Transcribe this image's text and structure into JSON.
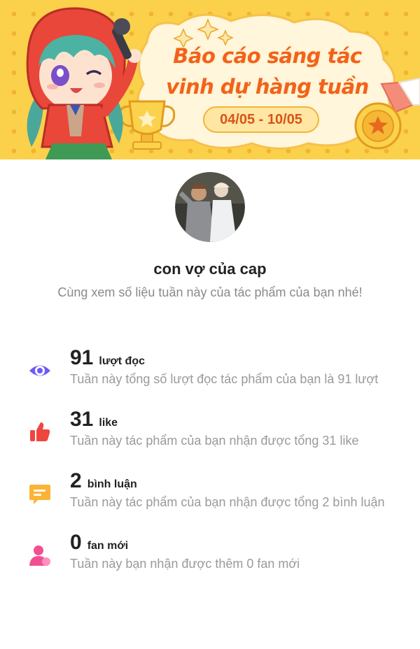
{
  "banner": {
    "title_line1": "Báo cáo sáng tác",
    "title_line2": "vinh dự hàng tuần",
    "date_range": "04/05 - 10/05"
  },
  "profile": {
    "username": "con vợ của cap",
    "subtitle": "Cùng xem số liệu tuần này của tác phẩm của bạn nhé!"
  },
  "stats": [
    {
      "icon": "eye-icon",
      "color": "#6b5cf5",
      "value": "91",
      "unit": "lượt đọc",
      "description": "Tuần này tổng số lượt đọc tác phẩm của bạn là 91 lượt"
    },
    {
      "icon": "thumbs-up-icon",
      "color": "#f0453f",
      "value": "31",
      "unit": "like",
      "description": "Tuần này tác phẩm của bạn nhận được tổng 31 like"
    },
    {
      "icon": "comment-icon",
      "color": "#fbb437",
      "value": "2",
      "unit": "bình luận",
      "description": "Tuần này tác phẩm của bạn nhận được tổng 2 bình luận"
    },
    {
      "icon": "user-icon",
      "color": "#f24f93",
      "value": "0",
      "unit": "fan mới",
      "description": "Tuần này bạn nhận được thêm 0 fan mới"
    }
  ]
}
